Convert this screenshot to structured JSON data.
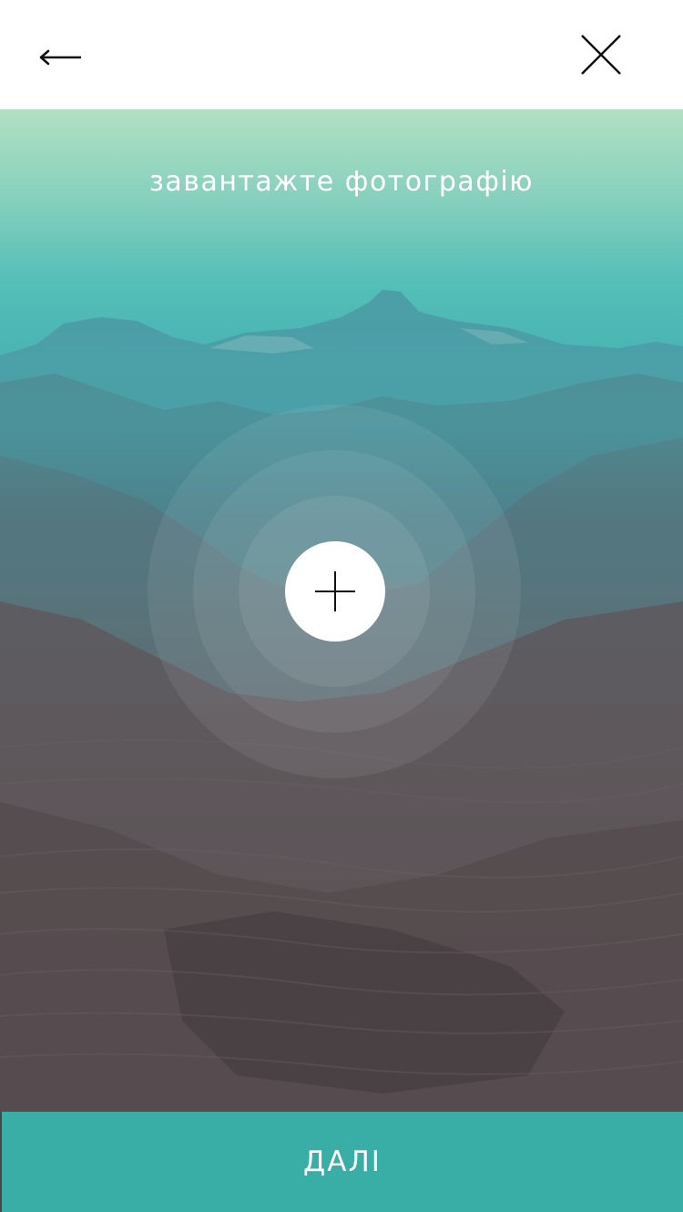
{
  "header": {
    "back_icon": "arrow-left-icon",
    "close_icon": "close-icon"
  },
  "upload": {
    "title": "завантажте фотографію",
    "add_icon": "plus-icon"
  },
  "footer": {
    "next_label": "ДАЛІ"
  },
  "colors": {
    "accent": "#38aea7",
    "gradient_top": "#b2e0c4",
    "gradient_mid": "#4fbcb8",
    "photo_dark": "#5d5456"
  }
}
